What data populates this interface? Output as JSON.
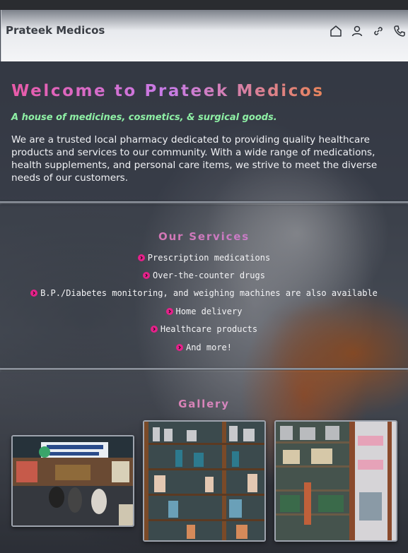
{
  "navbar": {
    "brand": "Prateek Medicos",
    "icons": [
      "home-icon",
      "user-icon",
      "link-icon",
      "phone-icon"
    ]
  },
  "hero": {
    "title": "Welcome to Prateek Medicos",
    "tagline": "A house of medicines, cosmetics, & surgical goods.",
    "description": "We are a trusted local pharmacy dedicated to providing quality healthcare products and services to our community. With a wide range of medications, health supplements, and personal care items, we strive to meet the diverse needs of our customers."
  },
  "services": {
    "title": "Our Services",
    "items": [
      "Prescription medications",
      "Over-the-counter drugs",
      "B.P./Diabetes monitoring, and weighing machines are also available",
      "Home delivery",
      "Healthcare products",
      "And more!"
    ]
  },
  "gallery": {
    "title": "Gallery"
  },
  "colors": {
    "accent_pink": "#e5218a",
    "tagline_green": "#8ef0a5",
    "title_gradient_start": "#e95aa8",
    "title_gradient_mid": "#c77ce8",
    "title_gradient_end": "#e8845a"
  }
}
